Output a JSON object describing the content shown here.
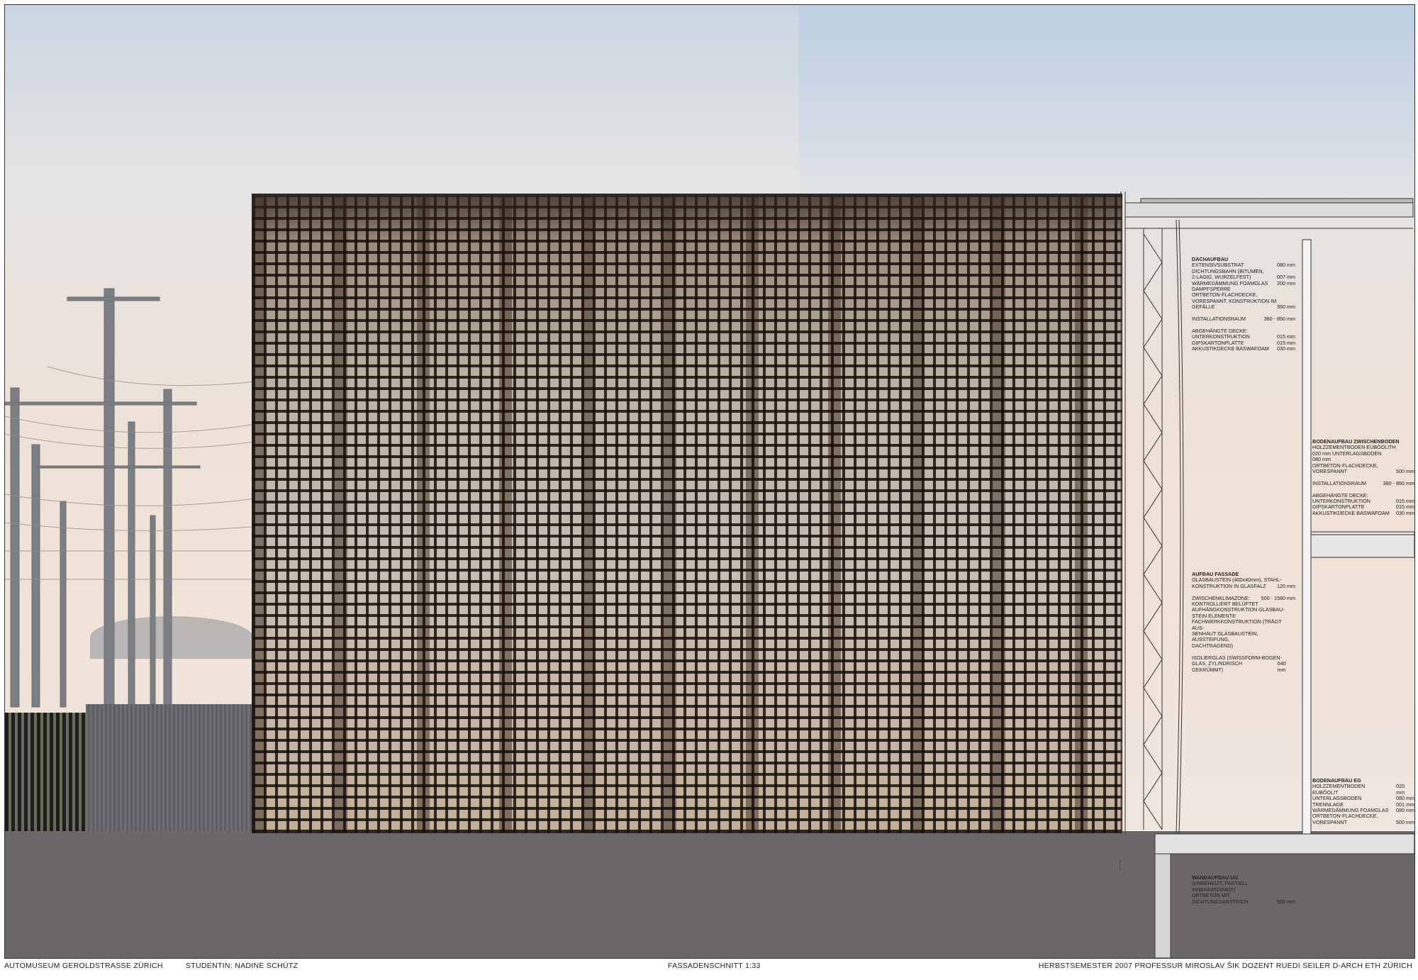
{
  "footer": {
    "project": "AUTOMUSEUM GEROLDSTRASSE   ZÜRICH",
    "student": "STUDENTIN: NADINE SCHÜTZ",
    "drawing": "FASSADENSCHNITT 1:33",
    "credits": "HERBSTSEMESTER 2007   PROFESSUR MIROSLAV ŠIK   DOZENT RUEDI SEILER   D-ARCH   ETH ZÜRICH"
  },
  "notes": {
    "dachaufbau": {
      "title": "DACHAUFBAU",
      "rows": [
        {
          "label": "EXTENSIVSUBSTRAT",
          "value": "080 mm"
        },
        {
          "label": "DICHTUNGSBAHN (BITUMEN,",
          "value": ""
        },
        {
          "label": "2-LAGIG, WURZELFEST)",
          "value": "007 mm"
        },
        {
          "label": "WÄRMEDÄMMUNG FOAMGLAS",
          "value": "200 mm"
        },
        {
          "label": "DAMPFSPERRE",
          "value": ""
        },
        {
          "label": "ORTBETON-FLACHDECKE,",
          "value": ""
        },
        {
          "label": "VORESPANNT, KONSTRUKTION IM",
          "value": ""
        },
        {
          "label": "GEFÄLLE",
          "value": "350 mm"
        },
        {
          "label": "",
          "value": ""
        },
        {
          "label": "INSTALLATIONSRAUM",
          "value": "380 - 850 mm"
        },
        {
          "label": "",
          "value": ""
        },
        {
          "label": "ABGEHÄNGTE DECKE:",
          "value": ""
        },
        {
          "label": "UNTERKONSTRUKTION",
          "value": "015 mm"
        },
        {
          "label": "GIPSKARTONPLATTE",
          "value": "015 mm"
        },
        {
          "label": "AKKUSTIKDECKE BASWAFOAM",
          "value": "030 mm"
        }
      ]
    },
    "zwischenboden": {
      "title": "BODENAUFBAU ZWISCHENBODEN",
      "rows": [
        {
          "label": "HOLZZEMENTBODEN EUBÖOLITH",
          "value": ""
        },
        {
          "label": "020 mm      UNTERLAGSBODEN",
          "value": ""
        },
        {
          "label": "      080 mm",
          "value": ""
        },
        {
          "label": "ORTBETON-FLACHDECKE,",
          "value": ""
        },
        {
          "label": "VORESPANNT",
          "value": "500 mm"
        },
        {
          "label": "",
          "value": ""
        },
        {
          "label": "INSTALLATIONSRAUM",
          "value": "380 - 850 mm"
        },
        {
          "label": "",
          "value": ""
        },
        {
          "label": "ABGEHÄNGTE DECKE:",
          "value": ""
        },
        {
          "label": "UNTERKONSTRUKTION",
          "value": "015 mm"
        },
        {
          "label": "GIPSKARTONPLATTE",
          "value": "015 mm"
        },
        {
          "label": "AKKUSTIKDECKE BASWAFOAM",
          "value": "030 mm"
        }
      ]
    },
    "fassade": {
      "title": "AUFBAU FASSADE",
      "rows": [
        {
          "label": "GLASBAUSTEIN (400x40mm), STAHL-",
          "value": ""
        },
        {
          "label": "KONSTRUKTION IN GLASFALZ",
          "value": "120 mm"
        },
        {
          "label": "",
          "value": ""
        },
        {
          "label": "ZWISCHENKLIMAZONE:",
          "value": "500 - 1580 mm"
        },
        {
          "label": "KONTROLLIERT BELÜFTET",
          "value": ""
        },
        {
          "label": "AUFHÄNGKONSTRUKTION GLASBAU-",
          "value": ""
        },
        {
          "label": "STEIN ELEMENTE",
          "value": ""
        },
        {
          "label": "FACHWERKKONSTRUKTION (TRÄGT AUS-",
          "value": ""
        },
        {
          "label": "SENHAUT GLASBAUSTEIN, AUSSTEIFUNG,",
          "value": ""
        },
        {
          "label": "DACHTRAGEND)",
          "value": ""
        },
        {
          "label": "",
          "value": ""
        },
        {
          "label": "ISOLIERGLAS (SWISSFORM-BOGEN-",
          "value": ""
        },
        {
          "label": "GLAS, ZYLINDRISCH GEKRÜMMT)",
          "value": "040 mm"
        }
      ]
    },
    "eg": {
      "title": "BODENAUFBAU EG",
      "rows": [
        {
          "label": "HOLZZEMENTBODEN EUBÖOLIT",
          "value": "020 mm"
        },
        {
          "label": "UNTERLAGSBODEN",
          "value": "080 mm"
        },
        {
          "label": "TRENNLAGE",
          "value": "001 mm"
        },
        {
          "label": "WÄRMEDÄMMUNG FOAMGLAS",
          "value": "080 mm"
        },
        {
          "label": "ORTBETON-FLACHDECKE,",
          "value": ""
        },
        {
          "label": "VORESPANNT",
          "value": "500 mm"
        }
      ]
    },
    "ug": {
      "title": "WANDAUFBAU UG",
      "rows": [
        {
          "label": "(UNBEHEIZT, PARTIELL INNENGEDÄMMT)",
          "value": ""
        },
        {
          "label": "ORTBETON MIT",
          "value": ""
        },
        {
          "label": "DICHTUNGSANSTRICH",
          "value": "500 mm"
        }
      ]
    }
  }
}
